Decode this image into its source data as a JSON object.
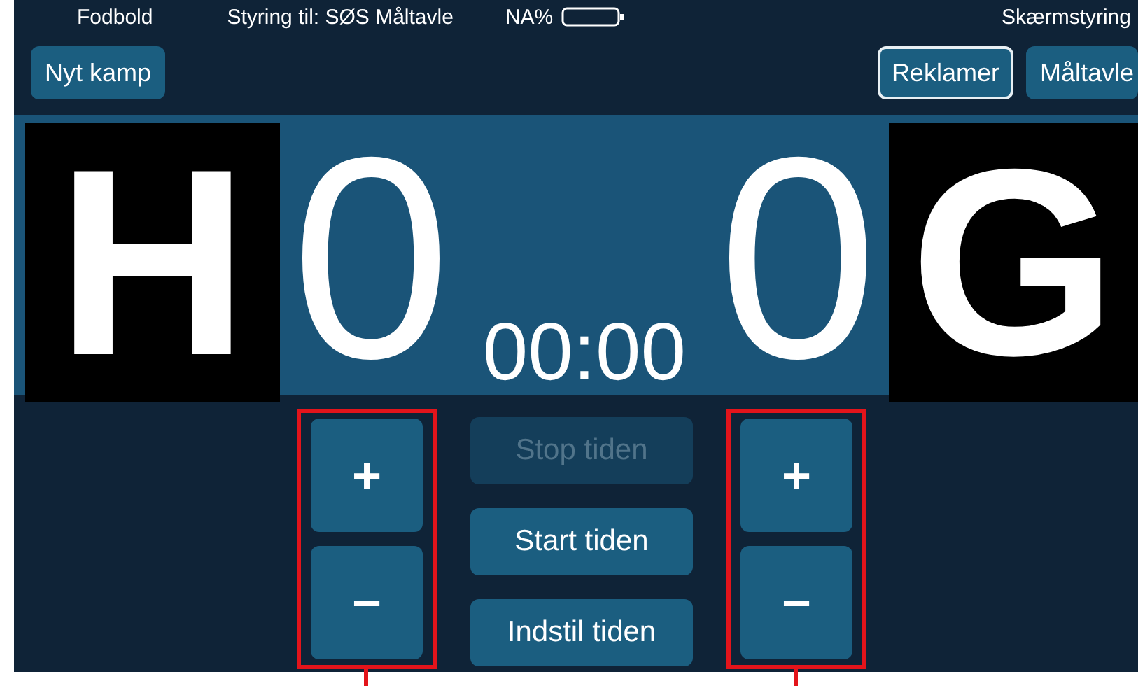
{
  "header": {
    "sport": "Fodbold",
    "control_target": "Styring til: SØS Måltavle",
    "battery": "NA%",
    "screen_control": "Skærmstyring"
  },
  "new_match_button": "Nyt kamp",
  "screen_tabs": [
    {
      "label": "Reklamer",
      "selected": true
    },
    {
      "label": "Måltavle",
      "selected": false
    }
  ],
  "scoreboard": {
    "home": {
      "letter": "H",
      "score": "0"
    },
    "away": {
      "letter": "G",
      "score": "0"
    },
    "timer": "00:00"
  },
  "home_controls": {
    "highlighted": true,
    "buttons": [
      {
        "label": "+"
      },
      {
        "label": "−"
      }
    ]
  },
  "timer_buttons": [
    {
      "label": "Stop tiden",
      "disabled": true
    },
    {
      "label": "Start tiden",
      "disabled": false
    },
    {
      "label": "Indstil tiden",
      "disabled": false
    }
  ],
  "away_controls": {
    "highlighted": true,
    "buttons": [
      {
        "label": "+"
      },
      {
        "label": "−"
      }
    ]
  }
}
